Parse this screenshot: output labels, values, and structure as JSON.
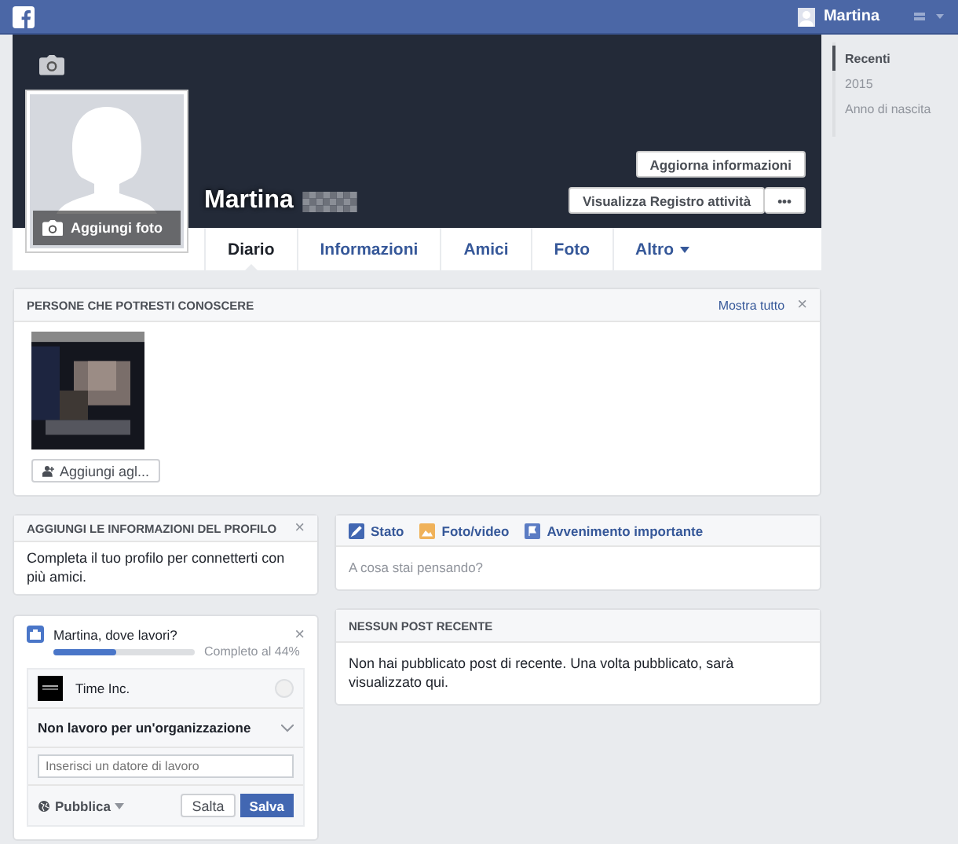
{
  "topbar": {
    "user": "Martina"
  },
  "profile": {
    "name": "Martina",
    "add_photo": "Aggiungi foto",
    "buttons": [
      "Aggiorna informazioni",
      "Visualizza Registro attività"
    ],
    "more": "•••"
  },
  "tabs": [
    {
      "label": "Diario",
      "selected": true
    },
    {
      "label": "Informazioni",
      "selected": false
    },
    {
      "label": "Amici",
      "selected": false
    },
    {
      "label": "Foto",
      "selected": false
    },
    {
      "label": "Altro",
      "selected": false,
      "dropdown": true
    }
  ],
  "timeline_nav": [
    {
      "label": "Recenti",
      "selected": true
    },
    {
      "label": "2015",
      "selected": false
    },
    {
      "label": "Anno di nascita",
      "selected": false
    }
  ],
  "people": {
    "title": "PERSONE CHE POTRESTI CONOSCERE",
    "show_all": "Mostra tutto",
    "close": "×",
    "add_button": "Aggiungi agl..."
  },
  "profile_info": {
    "title": "AGGIUNGI LE INFORMAZIONI DEL PROFILO",
    "close": "×",
    "text": "Completa il tuo profilo per connetterti con più amici."
  },
  "work": {
    "question": "Martina, dove lavori?",
    "close": "×",
    "level": 0.44,
    "progress_text": "Completo al 44%",
    "options": [
      {
        "label": "Time Inc.",
        "selected": false
      }
    ],
    "none_option": "Non lavoro per un'organizzazione",
    "placeholder": "Inserisci un datore di lavoro",
    "privacy": "Pubblica",
    "skip": "Salta",
    "save": "Salva"
  },
  "composer": {
    "actions": [
      {
        "kind": "status",
        "label": "Stato"
      },
      {
        "label": "Foto/video"
      },
      {
        "kind": "event",
        "label": "Avvenimento importante"
      }
    ],
    "placeholder": "A cosa stai pensando?"
  },
  "recent": {
    "title": "NESSUN POST RECENTE",
    "text": "Non hai pubblicato post di recente. Una volta pubblicato, sarà visualizzato qui."
  }
}
